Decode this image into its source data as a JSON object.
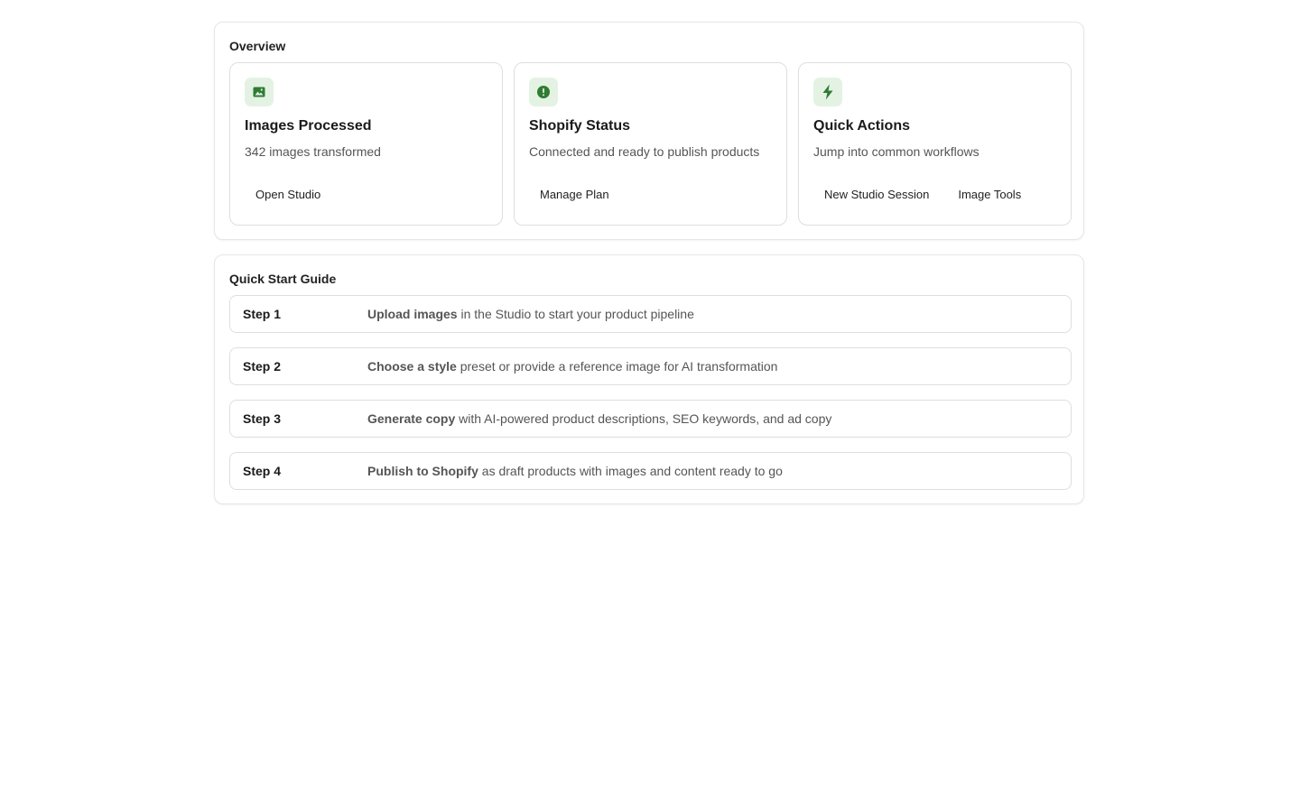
{
  "colors": {
    "accent": "#2e7d32",
    "icon_bg": "#e4f2e4",
    "border": "#dedede",
    "muted_text": "#555555"
  },
  "overview": {
    "title": "Overview",
    "cards": [
      {
        "icon": "image-icon",
        "title": "Images Processed",
        "description": "342 images transformed",
        "actions": [
          "Open Studio"
        ]
      },
      {
        "icon": "alert-circle-icon",
        "title": "Shopify Status",
        "description": "Connected and ready to publish products",
        "actions": [
          "Manage Plan"
        ]
      },
      {
        "icon": "lightning-icon",
        "title": "Quick Actions",
        "description": "Jump into common workflows",
        "actions": [
          "New Studio Session",
          "Image Tools"
        ]
      }
    ]
  },
  "guide": {
    "title": "Quick Start Guide",
    "steps": [
      {
        "label": "Step 1",
        "bold": "Upload images",
        "rest": " in the Studio to start your product pipeline"
      },
      {
        "label": "Step 2",
        "bold": "Choose a style",
        "rest": " preset or provide a reference image for AI transformation"
      },
      {
        "label": "Step 3",
        "bold": "Generate copy",
        "rest": " with AI-powered product descriptions, SEO keywords, and ad copy"
      },
      {
        "label": "Step 4",
        "bold": "Publish to Shopify",
        "rest": " as draft products with images and content ready to go"
      }
    ]
  }
}
